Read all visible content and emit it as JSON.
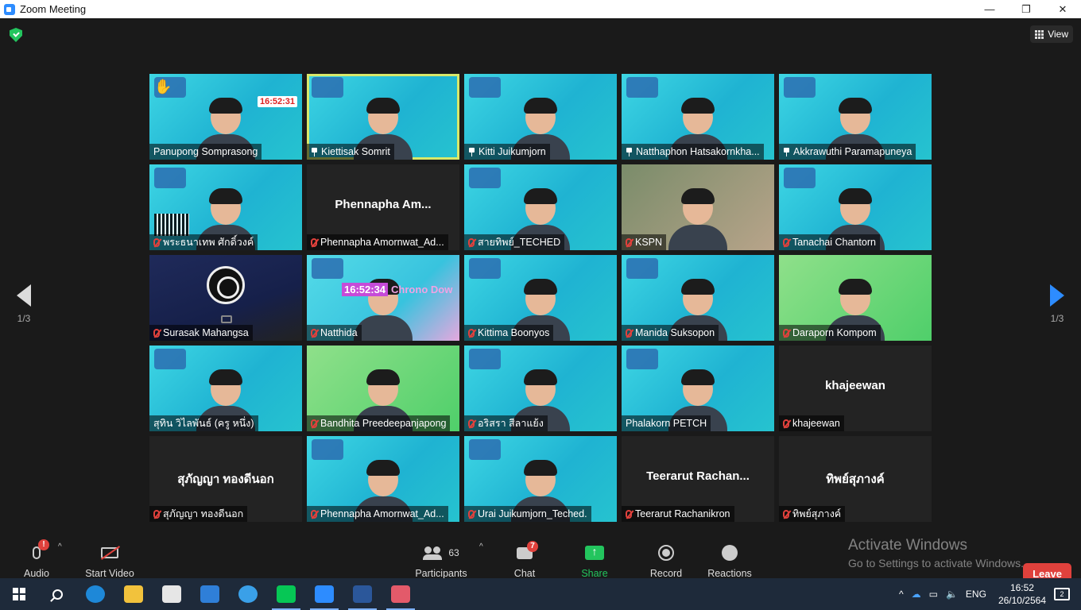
{
  "window": {
    "title": "Zoom Meeting",
    "minimize": "—",
    "maximize": "❐",
    "close": "✕"
  },
  "view_label": "View",
  "pager": {
    "left": "1/3",
    "right": "1/3"
  },
  "tiles": [
    {
      "name": "Panupong Somprasong",
      "big": "",
      "kind": "video",
      "icon": "none",
      "clock": "16:52:31",
      "hand": true
    },
    {
      "name": "Kiettisak Somrit",
      "big": "",
      "kind": "video",
      "icon": "pin",
      "active": true
    },
    {
      "name": "Kitti Juikumjorn",
      "big": "",
      "kind": "video",
      "icon": "pin"
    },
    {
      "name": "Natthaphon Hatsakornkha...",
      "big": "",
      "kind": "video",
      "icon": "pin"
    },
    {
      "name": "Akkrawuthi Paramapuneya",
      "big": "",
      "kind": "video",
      "icon": "pin"
    },
    {
      "name": "พระธนาเทพ ศักดิ์วงค์",
      "big": "",
      "kind": "video",
      "icon": "mic-off",
      "qr": true
    },
    {
      "name": "Phennapha Amornwat_Ad...",
      "big": "Phennapha Am...",
      "kind": "blank",
      "icon": "mic-off"
    },
    {
      "name": "สายทิพย์_TECHED",
      "big": "",
      "kind": "video",
      "icon": "mic-off"
    },
    {
      "name": "KSPN",
      "big": "",
      "kind": "room",
      "icon": "mic-off"
    },
    {
      "name": "Tanachai Chantorn",
      "big": "",
      "kind": "video",
      "icon": "mic-off"
    },
    {
      "name": "Surasak Mahangsa",
      "big": "",
      "kind": "obs",
      "icon": "mic-off"
    },
    {
      "name": "Natthida",
      "big": "",
      "kind": "pink",
      "icon": "mic-off",
      "chrono_time": "16:52:34",
      "chrono_text": "Chrono Dow"
    },
    {
      "name": "Kittima Boonyos",
      "big": "",
      "kind": "video",
      "icon": "mic-off"
    },
    {
      "name": "Manida Suksopon",
      "big": "",
      "kind": "video",
      "icon": "mic-off"
    },
    {
      "name": "Daraporn Kompom",
      "big": "",
      "kind": "green",
      "icon": "mic-off"
    },
    {
      "name": "สุทิน วิไลพันธ์ (ครู หนึ่ง)",
      "big": "",
      "kind": "video",
      "icon": "none"
    },
    {
      "name": "Bandhita Preedeepanjapong",
      "big": "",
      "kind": "green",
      "icon": "mic-off"
    },
    {
      "name": "อริสรา สีลาแย้ง",
      "big": "",
      "kind": "video",
      "icon": "mic-off"
    },
    {
      "name": "Phalakorn PETCH",
      "big": "",
      "kind": "video",
      "icon": "none"
    },
    {
      "name": "khajeewan",
      "big": "khajeewan",
      "kind": "blank",
      "icon": "mic-off"
    },
    {
      "name": "สุภัญญา ทองดีนอก",
      "big": "สุภัญญา ทองดีนอก",
      "kind": "blank",
      "icon": "mic-off"
    },
    {
      "name": "Phennapha Amornwat_Ad...",
      "big": "",
      "kind": "video",
      "icon": "mic-off"
    },
    {
      "name": "Urai Juikumjorn_Teched.",
      "big": "",
      "kind": "video",
      "icon": "mic-off"
    },
    {
      "name": "Teerarut Rachanikron",
      "big": "Teerarut Rachan...",
      "kind": "blank",
      "icon": "mic-off"
    },
    {
      "name": "ทิพย์สุภางค์",
      "big": "ทิพย์สุภางค์",
      "kind": "blank",
      "icon": "mic-off"
    }
  ],
  "toolbar": {
    "audio": "Audio",
    "audio_badge": "!",
    "start_video": "Start Video",
    "participants": "Participants",
    "participants_count": "63",
    "chat": "Chat",
    "chat_badge": "7",
    "share_screen": "Share Screen",
    "record": "Record",
    "reactions": "Reactions",
    "leave": "Leave"
  },
  "watermark": {
    "line1": "Activate Windows",
    "line2": "Go to Settings to activate Windows."
  },
  "taskbar": {
    "lang": "ENG",
    "time": "16:52",
    "date": "26/10/2564",
    "notifications": "2",
    "apps": [
      "edge-icon",
      "file-explorer-icon",
      "store-icon",
      "mail-icon",
      "ie-icon",
      "line-icon",
      "zoom-icon",
      "word-icon",
      "acrobat-icon"
    ]
  },
  "colors": {
    "accent": "#2d8cff",
    "leave": "#e0413c",
    "share": "#23c55e",
    "active_speaker": "#d8e86a"
  }
}
